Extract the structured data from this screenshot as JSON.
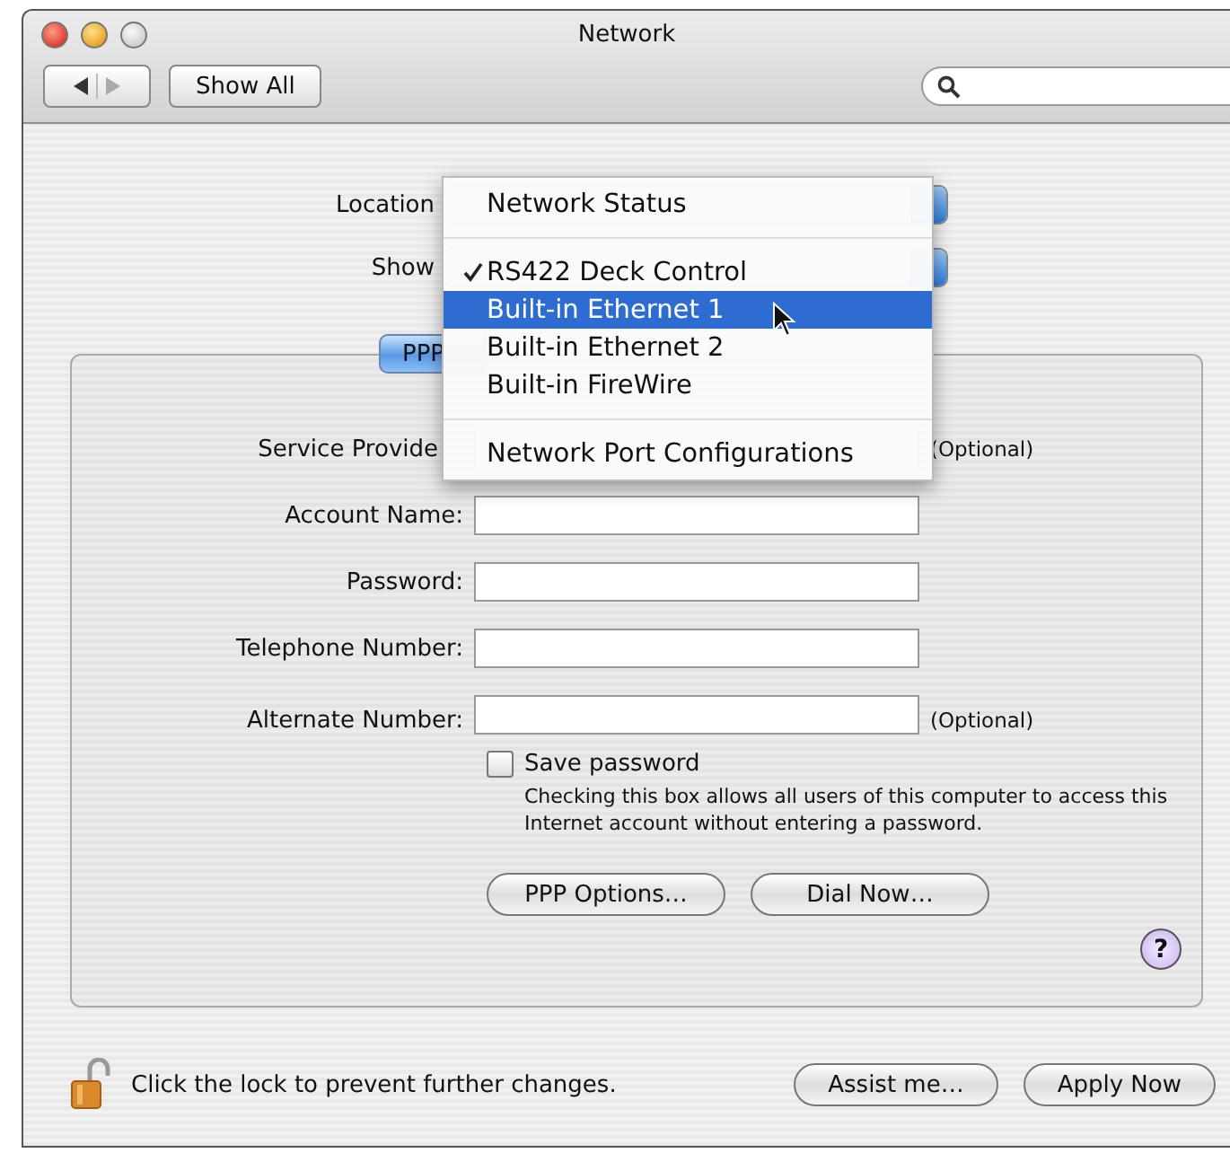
{
  "window": {
    "title": "Network"
  },
  "toolbar": {
    "show_all": "Show All"
  },
  "location": {
    "label": "Location"
  },
  "show": {
    "label": "Show"
  },
  "tabs": [
    {
      "label": "PPP",
      "selected": true
    }
  ],
  "fields": [
    {
      "label": "Service Provide",
      "note": "(Optional)"
    },
    {
      "label": "Account Name:"
    },
    {
      "label": "Password:"
    },
    {
      "label": "Telephone Number:"
    },
    {
      "label": "Alternate Number:",
      "note": "(Optional)"
    }
  ],
  "save_password": {
    "label": "Save password",
    "checked": false,
    "help": "Checking this box allows all users of this computer to access this Internet account without entering a password."
  },
  "buttons": [
    "PPP Options…",
    "Dial Now…"
  ],
  "help_button": "?",
  "lock": {
    "text": "Click the lock to prevent further changes.",
    "locked": false
  },
  "footer_buttons": [
    "Assist me…",
    "Apply Now"
  ],
  "menu": {
    "groups": [
      [
        {
          "label": "Network Status",
          "checked": false,
          "selected": false
        }
      ],
      [
        {
          "label": "RS422 Deck Control",
          "checked": true,
          "selected": false
        },
        {
          "label": "Built-in Ethernet 1",
          "checked": false,
          "selected": true
        },
        {
          "label": "Built-in Ethernet 2",
          "checked": false,
          "selected": false
        },
        {
          "label": "Built-in FireWire",
          "checked": false,
          "selected": false
        }
      ],
      [
        {
          "label": "Network Port Configurations",
          "checked": false,
          "selected": false
        }
      ]
    ]
  }
}
